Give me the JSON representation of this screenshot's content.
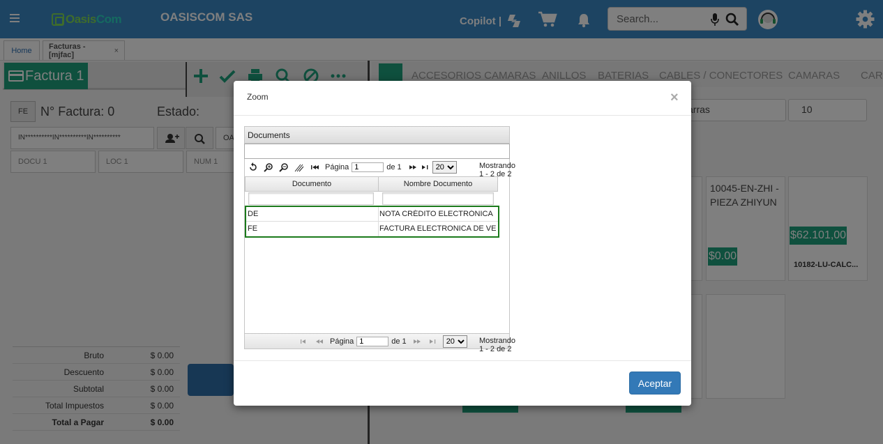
{
  "header": {
    "company": "OASISCOM SAS",
    "copilot_label": "Copilot |",
    "search_placeholder": "Search...",
    "colors": {
      "bar": "#3b89c5",
      "accent": "#1fa07c"
    }
  },
  "tabs": [
    {
      "label": "Home"
    },
    {
      "label": "Facturas -[mjfac]",
      "close": "×"
    }
  ],
  "invoice": {
    "tab_title": "Factura 1",
    "doc_type": "FE",
    "number_label": "N° Factura: 0",
    "state_label": "Estado:",
    "client_value": "IN**********IN**********IN**********",
    "client_partial": "OA",
    "docu_placeholder": "DOCU 1",
    "loc_placeholder": "LOC 1",
    "num_placeholder": "NUM 1"
  },
  "categories": [
    "ACCESORIOS CAMARAS",
    "ANILLOS",
    "BATERIAS",
    "CABLES / CONECTORES",
    "CAMARAS",
    "CARG"
  ],
  "filters": {
    "brand_partial": "arras",
    "page_size": "10"
  },
  "products": [
    {
      "title": "10045-EN-ZHI - PIEZA ZHIYUN",
      "price": "$0.00"
    },
    {
      "price": "$62.101,00",
      "code": "10182-LU-CALC..."
    }
  ],
  "totals": [
    {
      "label": "Bruto",
      "value": "$ 0.00"
    },
    {
      "label": "Descuento",
      "value": "$ 0.00"
    },
    {
      "label": "Subtotal",
      "value": "$ 0.00"
    },
    {
      "label": "Total Impuestos",
      "value": "$ 0.00"
    },
    {
      "label": "Total a Pagar",
      "value": "$ 0.00"
    }
  ],
  "modal": {
    "title": "Zoom",
    "close": "×",
    "accept_label": "Aceptar",
    "grid": {
      "caption": "Documents",
      "page_label": "Página",
      "page_value": "1",
      "of_label": "de 1",
      "page_size": "20",
      "page_size_options": [
        "20"
      ],
      "count_text": "Mostrando 1 - 2 de 2",
      "columns": [
        "Documento",
        "Nombre Documento"
      ],
      "rows": [
        {
          "code": "DE",
          "name": "NOTA CRÉDITO ELECTRÓNICA"
        },
        {
          "code": "FE",
          "name": "FACTURA ELECTRONICA DE VE"
        }
      ]
    }
  }
}
